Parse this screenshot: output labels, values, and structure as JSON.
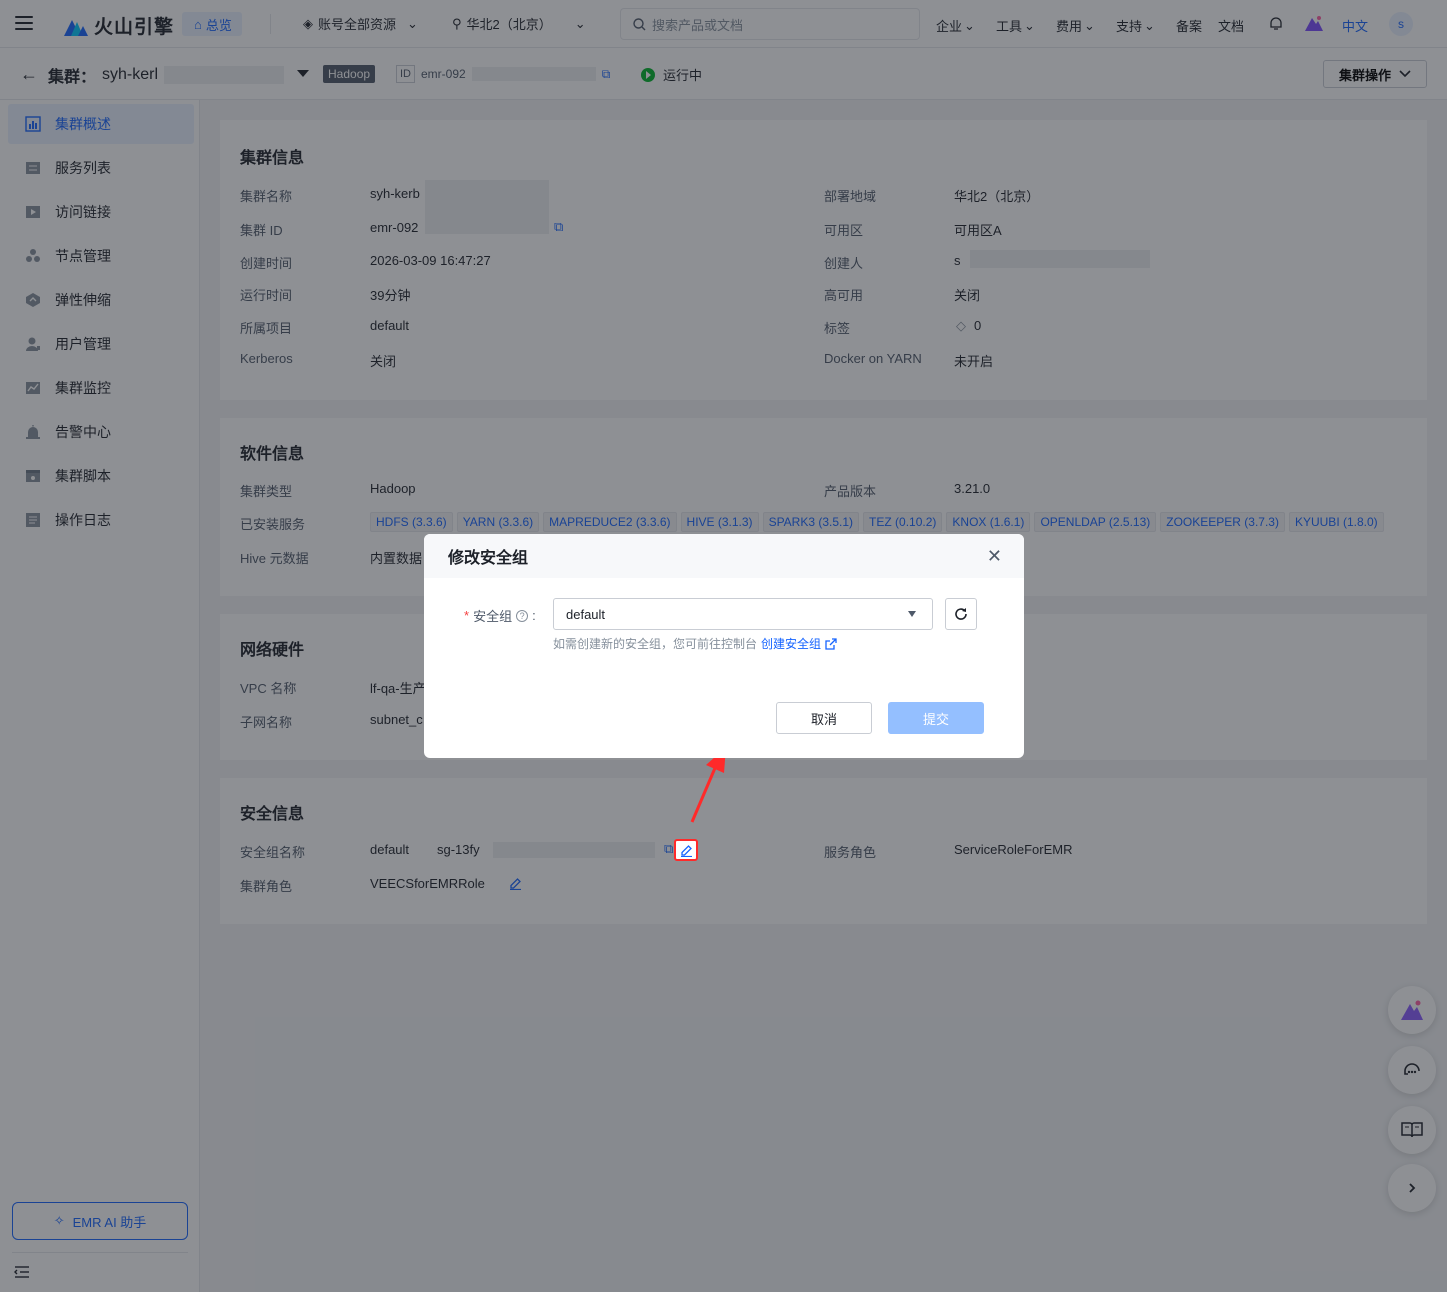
{
  "nav": {
    "logo": "火山引擎",
    "home": "总览",
    "resources": "账号全部资源",
    "region": "华北2（北京）",
    "search_placeholder": "搜索产品或文档",
    "menus": [
      "企业",
      "工具",
      "费用",
      "支持"
    ],
    "links": [
      "备案",
      "文档"
    ],
    "lang": "中文",
    "avatar": "s"
  },
  "header": {
    "title_prefix": "集群：",
    "cluster_name": "syh-kerl",
    "type_tag": "Hadoop",
    "id_label": "ID",
    "id_value": "emr-092",
    "status": "运行中",
    "ops_button": "集群操作"
  },
  "sidebar": {
    "items": [
      {
        "label": "集群概述",
        "icon": "bar-chart-icon",
        "active": true
      },
      {
        "label": "服务列表",
        "icon": "list-icon"
      },
      {
        "label": "访问链接",
        "icon": "play-box-icon"
      },
      {
        "label": "节点管理",
        "icon": "nodes-icon"
      },
      {
        "label": "弹性伸缩",
        "icon": "scale-icon"
      },
      {
        "label": "用户管理",
        "icon": "user-icon"
      },
      {
        "label": "集群监控",
        "icon": "monitor-icon"
      },
      {
        "label": "告警中心",
        "icon": "alarm-icon"
      },
      {
        "label": "集群脚本",
        "icon": "script-icon"
      },
      {
        "label": "操作日志",
        "icon": "log-icon"
      }
    ],
    "ai_button": "EMR AI 助手"
  },
  "cluster_info": {
    "title": "集群信息",
    "left": [
      {
        "k": "集群名称",
        "v": "syh-kerb"
      },
      {
        "k": "集群 ID",
        "v": "emr-092"
      },
      {
        "k": "创建时间",
        "v": "2026-03-09 16:47:27"
      },
      {
        "k": "运行时间",
        "v": "39分钟"
      },
      {
        "k": "所属项目",
        "v": "default"
      },
      {
        "k": "Kerberos",
        "v": "关闭"
      }
    ],
    "right": [
      {
        "k": "部署地域",
        "v": "华北2（北京）"
      },
      {
        "k": "可用区",
        "v": "可用区A"
      },
      {
        "k": "创建人",
        "v": "s"
      },
      {
        "k": "高可用",
        "v": "关闭"
      },
      {
        "k": "标签",
        "v": "0"
      },
      {
        "k": "Docker on YARN",
        "v": "未开启"
      }
    ]
  },
  "software_info": {
    "title": "软件信息",
    "cluster_type_k": "集群类型",
    "cluster_type_v": "Hadoop",
    "version_k": "产品版本",
    "version_v": "3.21.0",
    "services_k": "已安装服务",
    "services": [
      "HDFS (3.3.6)",
      "YARN (3.3.6)",
      "MAPREDUCE2 (3.3.6)",
      "HIVE (3.1.3)",
      "SPARK3 (3.5.1)",
      "TEZ (0.10.2)",
      "KNOX (1.6.1)",
      "OPENLDAP (2.5.13)",
      "ZOOKEEPER (3.7.3)",
      "KYUUBI (1.8.0)"
    ],
    "hive_k": "Hive 元数据",
    "hive_v": "内置数据"
  },
  "network_info": {
    "title": "网络硬件",
    "vpc_k": "VPC 名称",
    "vpc_v": "lf-qa-生产",
    "subnet_k": "子网名称",
    "subnet_v": "subnet_c"
  },
  "security_info": {
    "title": "安全信息",
    "sg_k": "安全组名称",
    "sg_v": "default",
    "sg_id": "sg-13fy",
    "role_k": "集群角色",
    "role_v": "VEECSforEMRRole",
    "svc_role_k": "服务角色",
    "svc_role_v": "ServiceRoleForEMR"
  },
  "modal": {
    "title": "修改安全组",
    "field_label": "安全组",
    "field_colon": ":",
    "required_mark": "*",
    "select_value": "default",
    "hint": "如需创建新的安全组，您可前往控制台",
    "hint_link": "创建安全组",
    "cancel": "取消",
    "submit": "提交"
  },
  "colors": {
    "primary": "#1664ff",
    "success": "#00b42a",
    "annotation": "#ff2a2a",
    "submit_disabled": "#94bfff"
  }
}
